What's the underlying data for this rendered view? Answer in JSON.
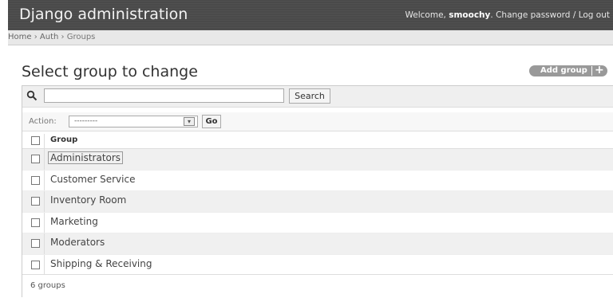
{
  "header": {
    "site_name": "Django administration",
    "welcome": "Welcome,",
    "username": "smoochy",
    "change_password": "Change password",
    "separator": "/",
    "logout": "Log out"
  },
  "breadcrumbs": {
    "items": [
      "Home",
      "Auth",
      "Groups"
    ],
    "separator": "›"
  },
  "page": {
    "title": "Select group to change",
    "add_label": "Add group",
    "add_icon": "plus-icon"
  },
  "search": {
    "value": "",
    "placeholder": "",
    "button": "Search",
    "icon": "search-icon"
  },
  "actions": {
    "label": "Action:",
    "selected": "---------",
    "go": "Go"
  },
  "table": {
    "header": "Group",
    "rows": [
      "Administrators",
      "Customer Service",
      "Inventory Room",
      "Marketing",
      "Moderators",
      "Shipping & Receiving"
    ]
  },
  "paginator": "6 groups"
}
